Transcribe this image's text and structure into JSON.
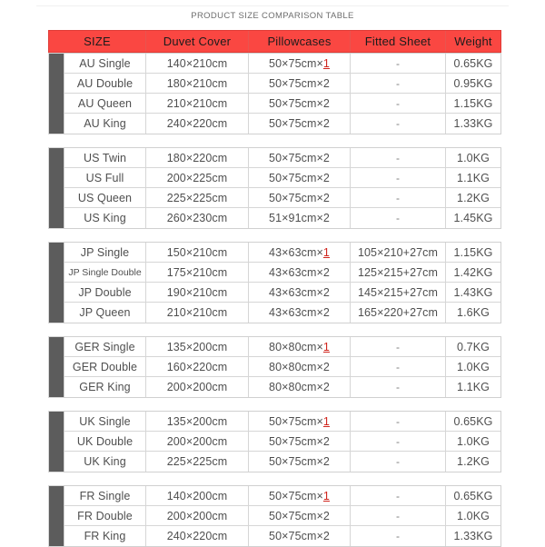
{
  "page": {
    "title": "PRODUCT SIZE COMPARISON TABLE"
  },
  "table": {
    "headers": [
      {
        "key": "size",
        "label": "SIZE"
      },
      {
        "key": "duvet",
        "label": "Duvet  Cover"
      },
      {
        "key": "pillow",
        "label": "Pillowcases"
      },
      {
        "key": "fitted",
        "label": "Fitted Sheet"
      },
      {
        "key": "weight",
        "label": "Weight"
      }
    ],
    "accent_color": "#fa4742",
    "gutter_color": "#5c5c5c",
    "highlight_color": "#d0241c",
    "dash": "-",
    "sections": [
      {
        "name": "AU",
        "rows": [
          {
            "size": "AU Single",
            "duvet": "140×210cm",
            "pillow_base": "50×75cm×",
            "pillow_qty": "1",
            "pillow_qty_highlight": true,
            "fitted": "-",
            "weight": "0.65KG"
          },
          {
            "size": "AU Double",
            "duvet": "180×210cm",
            "pillow_base": "50×75cm×",
            "pillow_qty": "2",
            "pillow_qty_highlight": false,
            "fitted": "-",
            "weight": "0.95KG"
          },
          {
            "size": "AU Queen",
            "duvet": "210×210cm",
            "pillow_base": "50×75cm×",
            "pillow_qty": "2",
            "pillow_qty_highlight": false,
            "fitted": "-",
            "weight": "1.15KG"
          },
          {
            "size": "AU  King",
            "duvet": "240×220cm",
            "pillow_base": "50×75cm×",
            "pillow_qty": "2",
            "pillow_qty_highlight": false,
            "fitted": "-",
            "weight": "1.33KG"
          }
        ]
      },
      {
        "name": "US",
        "rows": [
          {
            "size": "US Twin",
            "duvet": "180×220cm",
            "pillow_base": "50×75cm×",
            "pillow_qty": "2",
            "pillow_qty_highlight": false,
            "fitted": "-",
            "weight": "1.0KG"
          },
          {
            "size": "US Full",
            "duvet": "200×225cm",
            "pillow_base": "50×75cm×",
            "pillow_qty": "2",
            "pillow_qty_highlight": false,
            "fitted": "-",
            "weight": "1.1KG"
          },
          {
            "size": "US Queen",
            "duvet": "225×225cm",
            "pillow_base": "50×75cm×",
            "pillow_qty": "2",
            "pillow_qty_highlight": false,
            "fitted": "-",
            "weight": "1.2KG"
          },
          {
            "size": "US King",
            "duvet": "260×230cm",
            "pillow_base": "51×91cm×",
            "pillow_qty": "2",
            "pillow_qty_highlight": false,
            "fitted": "-",
            "weight": "1.45KG"
          }
        ]
      },
      {
        "name": "JP",
        "rows": [
          {
            "size": "JP Single",
            "duvet": "150×210cm",
            "pillow_base": "43×63cm×",
            "pillow_qty": "1",
            "pillow_qty_highlight": true,
            "fitted": "105×210+27cm",
            "weight": "1.15KG"
          },
          {
            "size": "JP Single Double",
            "size_small": true,
            "duvet": "175×210cm",
            "pillow_base": "43×63cm×",
            "pillow_qty": "2",
            "pillow_qty_highlight": false,
            "fitted": "125×215+27cm",
            "weight": "1.42KG"
          },
          {
            "size": "JP Double",
            "duvet": "190×210cm",
            "pillow_base": "43×63cm×",
            "pillow_qty": "2",
            "pillow_qty_highlight": false,
            "fitted": "145×215+27cm",
            "weight": "1.43KG"
          },
          {
            "size": "JP Queen",
            "duvet": "210×210cm",
            "pillow_base": "43×63cm×",
            "pillow_qty": "2",
            "pillow_qty_highlight": false,
            "fitted": "165×220+27cm",
            "weight": "1.6KG"
          }
        ]
      },
      {
        "name": "GER",
        "rows": [
          {
            "size": "GER Single",
            "duvet": "135×200cm",
            "pillow_base": "80×80cm×",
            "pillow_qty": "1",
            "pillow_qty_highlight": true,
            "fitted": "-",
            "weight": "0.7KG"
          },
          {
            "size": "GER Double",
            "duvet": "160×220cm",
            "pillow_base": "80×80cm×",
            "pillow_qty": "2",
            "pillow_qty_highlight": false,
            "fitted": "-",
            "weight": "1.0KG"
          },
          {
            "size": "GER King",
            "duvet": "200×200cm",
            "pillow_base": "80×80cm×",
            "pillow_qty": "2",
            "pillow_qty_highlight": false,
            "fitted": "-",
            "weight": "1.1KG"
          }
        ]
      },
      {
        "name": "UK",
        "rows": [
          {
            "size": "UK Single",
            "duvet": "135×200cm",
            "pillow_base": "50×75cm×",
            "pillow_qty": "1",
            "pillow_qty_highlight": true,
            "fitted": "-",
            "weight": "0.65KG"
          },
          {
            "size": "UK Double",
            "duvet": "200×200cm",
            "pillow_base": "50×75cm×",
            "pillow_qty": "2",
            "pillow_qty_highlight": false,
            "fitted": "-",
            "weight": "1.0KG"
          },
          {
            "size": "UK King",
            "duvet": "225×225cm",
            "pillow_base": "50×75cm×",
            "pillow_qty": "2",
            "pillow_qty_highlight": false,
            "fitted": "-",
            "weight": "1.2KG"
          }
        ]
      },
      {
        "name": "FR",
        "rows": [
          {
            "size": "FR Single",
            "duvet": "140×200cm",
            "pillow_base": "50×75cm×",
            "pillow_qty": "1",
            "pillow_qty_highlight": true,
            "fitted": "-",
            "weight": "0.65KG"
          },
          {
            "size": "FR Double",
            "duvet": "200×200cm",
            "pillow_base": "50×75cm×",
            "pillow_qty": "2",
            "pillow_qty_highlight": false,
            "fitted": "-",
            "weight": "1.0KG"
          },
          {
            "size": "FR King",
            "duvet": "240×220cm",
            "pillow_base": "50×75cm×",
            "pillow_qty": "2",
            "pillow_qty_highlight": false,
            "fitted": "-",
            "weight": "1.33KG"
          }
        ]
      }
    ]
  }
}
